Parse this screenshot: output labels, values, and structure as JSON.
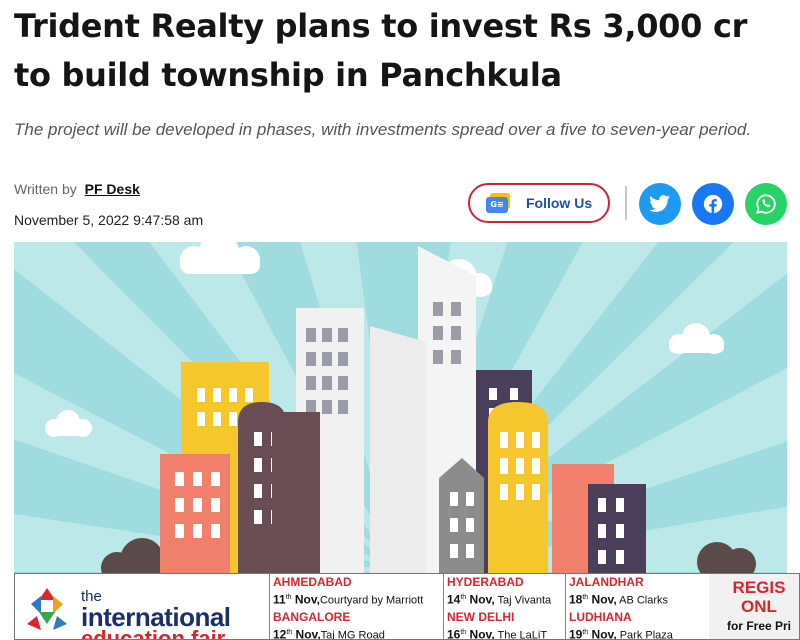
{
  "article": {
    "headline": "Trident Realty plans to invest Rs 3,000 cr to build township in Panchkula",
    "subhead": "The project will be developed in phases, with investments spread over a five to seven-year period.",
    "written_by_label": "Written by",
    "author": "PF Desk",
    "date": "November 5, 2022 9:47:58 am"
  },
  "follow": {
    "label": "Follow Us",
    "icon": "google-news-icon",
    "icon_text": "G≡",
    "border_color": "#c8283a"
  },
  "share": [
    {
      "name": "twitter",
      "icon": "twitter-icon",
      "color": "#1d9bf0"
    },
    {
      "name": "facebook",
      "icon": "facebook-icon",
      "color": "#1877f2"
    },
    {
      "name": "whatsapp",
      "icon": "whatsapp-icon",
      "color": "#25d366"
    }
  ],
  "hero": {
    "description_icon": "city-skyline-illustration",
    "sky_color": "#9fdcdf"
  },
  "ad": {
    "brand_the": "the",
    "brand_name": "international",
    "brand_name2": "education fair",
    "columns": [
      [
        {
          "city": "AHMEDABAD",
          "day": "11",
          "sup": "th",
          "rest": " Nov,",
          "venue": "Courtyard by Marriott"
        },
        {
          "city": "BANGALORE",
          "day": "12",
          "sup": "th",
          "rest": " Nov,",
          "venue": "Taj MG Road"
        }
      ],
      [
        {
          "city": "HYDERABAD",
          "day": "14",
          "sup": "th",
          "rest": " Nov,",
          "venue": " Taj Vivanta"
        },
        {
          "city": "NEW DELHI",
          "day": "16",
          "sup": "th",
          "rest": " Nov,",
          "venue": " The LaLiT"
        }
      ],
      [
        {
          "city": "JALANDHAR",
          "day": "18",
          "sup": "th",
          "rest": " Nov,",
          "venue": " AB Clarks"
        },
        {
          "city": "LUDHIANA",
          "day": "19",
          "sup": "th",
          "rest": " Nov,",
          "venue": " Park Plaza"
        }
      ]
    ],
    "register_line1": "REGIS",
    "register_line2": "ONL",
    "register_line3": "for Free Pri"
  }
}
